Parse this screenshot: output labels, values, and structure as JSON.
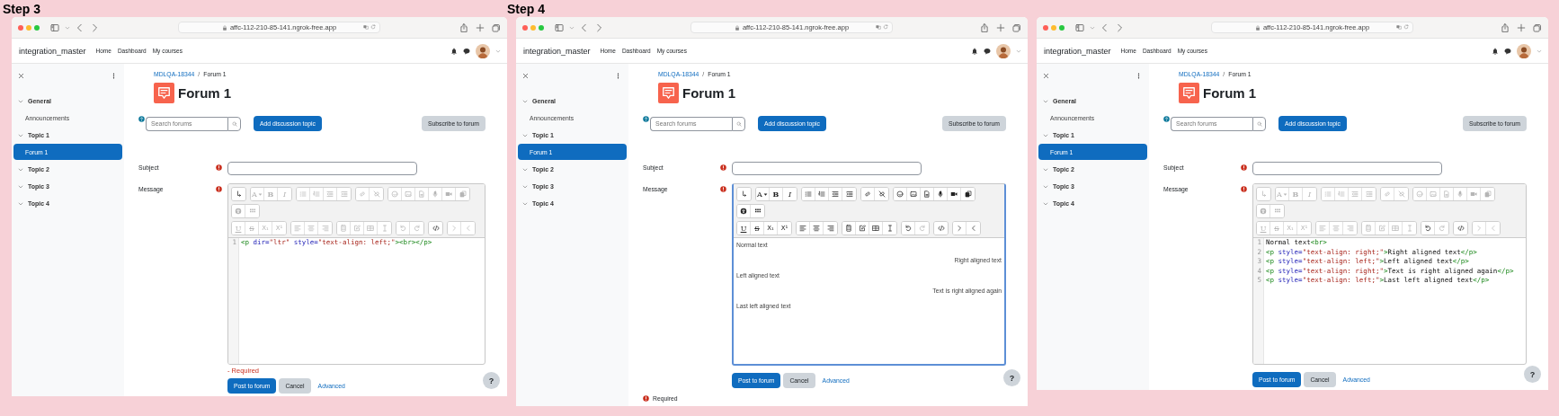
{
  "panels": [
    {
      "step_label": "Step 3",
      "browser": {
        "url": "affc-112-210-85-141.ngrok-free.app"
      },
      "site": {
        "brand": "integration_master",
        "nav": [
          "Home",
          "Dashboard",
          "My courses"
        ]
      },
      "sidebar": [
        {
          "label": "General",
          "expanded": true,
          "children": [
            {
              "label": "Announcements",
              "selected": false
            }
          ]
        },
        {
          "label": "Topic 1",
          "expanded": true,
          "children": [
            {
              "label": "Forum 1",
              "selected": true
            }
          ]
        },
        {
          "label": "Topic 2",
          "expanded": true
        },
        {
          "label": "Topic 3",
          "expanded": true
        },
        {
          "label": "Topic 4",
          "expanded": true
        }
      ],
      "breadcrumb": [
        {
          "label": "MDLQA-18344",
          "kind": "link"
        },
        {
          "label": "/",
          "kind": "separator"
        },
        {
          "label": "Forum 1",
          "kind": "current"
        }
      ],
      "title": "Forum 1",
      "search": {
        "placeholder": "Search forums"
      },
      "actions": [
        {
          "label": "Add discussion topic",
          "kind": "primary"
        },
        {
          "label": "Subscribe to forum",
          "kind": "secondary"
        }
      ],
      "subject": {
        "label": "Subject"
      },
      "message": {
        "label": "Message",
        "error": "- Required",
        "editor": {
          "kind": "source",
          "focused": false,
          "toolbar": [
            [
              [
                {
                  "kind": "expand",
                  "disabled": false
                }
              ],
              [
                {
                  "kind": "font",
                  "label": "A",
                  "disabled": true
                },
                {
                  "kind": "bold",
                  "label": "B",
                  "disabled": true
                },
                {
                  "kind": "italic",
                  "label": "I",
                  "disabled": true
                }
              ],
              [
                {
                  "kind": "ul",
                  "disabled": true
                },
                {
                  "kind": "ol",
                  "disabled": true
                },
                {
                  "kind": "outdent",
                  "disabled": true
                },
                {
                  "kind": "indent",
                  "disabled": true
                }
              ],
              [
                {
                  "kind": "link",
                  "disabled": true
                },
                {
                  "kind": "unlink",
                  "disabled": true
                }
              ],
              [
                {
                  "kind": "emoji",
                  "disabled": true
                },
                {
                  "kind": "image",
                  "disabled": true
                },
                {
                  "kind": "file",
                  "disabled": true
                },
                {
                  "kind": "mic",
                  "disabled": true
                },
                {
                  "kind": "video",
                  "disabled": true
                },
                {
                  "kind": "copy",
                  "disabled": true
                }
              ],
              [
                {
                  "kind": "accessibility",
                  "disabled": true
                },
                {
                  "kind": "grid",
                  "disabled": true
                }
              ]
            ],
            [
              [
                {
                  "kind": "underline",
                  "label": "U",
                  "disabled": true
                },
                {
                  "kind": "strike",
                  "label": "S",
                  "disabled": true
                },
                {
                  "kind": "sub",
                  "label": "X₁",
                  "disabled": true
                },
                {
                  "kind": "sup",
                  "label": "X¹",
                  "disabled": true
                }
              ],
              [
                {
                  "kind": "align-left",
                  "disabled": true
                },
                {
                  "kind": "align-center",
                  "disabled": true
                },
                {
                  "kind": "align-right",
                  "disabled": true
                }
              ],
              [
                {
                  "kind": "calculator",
                  "disabled": true
                },
                {
                  "kind": "edit",
                  "disabled": true
                },
                {
                  "kind": "table",
                  "disabled": true
                },
                {
                  "kind": "cursor",
                  "disabled": true
                }
              ],
              [
                {
                  "kind": "undo",
                  "disabled": true
                },
                {
                  "kind": "redo",
                  "disabled": true
                }
              ],
              [
                {
                  "kind": "code",
                  "disabled": false
                }
              ],
              [
                {
                  "kind": "next",
                  "disabled": true
                },
                {
                  "kind": "prev",
                  "disabled": true
                }
              ]
            ]
          ],
          "lines": [
            {
              "number": "1",
              "tokens": [
                {
                  "kind": "tag",
                  "text": "<p"
                },
                {
                  "kind": "attr",
                  "text": " dir="
                },
                {
                  "kind": "string",
                  "text": "\"ltr\""
                },
                {
                  "kind": "attr",
                  "text": " style="
                },
                {
                  "kind": "string",
                  "text": "\"text-align: left;\""
                },
                {
                  "kind": "tag",
                  "text": "><br></p>"
                }
              ]
            }
          ]
        }
      },
      "buttons": [
        {
          "label": "Post to forum",
          "kind": "primary"
        },
        {
          "label": "Cancel",
          "kind": "secondary"
        },
        {
          "label": "Advanced",
          "kind": "link"
        }
      ],
      "help": "?"
    },
    {
      "step_label": "Step 4",
      "browser": {
        "url": "affc-112-210-85-141.ngrok-free.app"
      },
      "site": {
        "brand": "integration_master",
        "nav": [
          "Home",
          "Dashboard",
          "My courses"
        ]
      },
      "sidebar": [
        {
          "label": "General",
          "expanded": true,
          "children": [
            {
              "label": "Announcements",
              "selected": false
            }
          ]
        },
        {
          "label": "Topic 1",
          "expanded": true,
          "children": [
            {
              "label": "Forum 1",
              "selected": true
            }
          ]
        },
        {
          "label": "Topic 2",
          "expanded": true
        },
        {
          "label": "Topic 3",
          "expanded": true
        },
        {
          "label": "Topic 4",
          "expanded": true
        }
      ],
      "breadcrumb": [
        {
          "label": "MDLQA-18344",
          "kind": "link"
        },
        {
          "label": "/",
          "kind": "separator"
        },
        {
          "label": "Forum 1",
          "kind": "current"
        }
      ],
      "title": "Forum 1",
      "search": {
        "placeholder": "Search forums"
      },
      "actions": [
        {
          "label": "Add discussion topic",
          "kind": "primary"
        },
        {
          "label": "Subscribe to forum",
          "kind": "secondary"
        }
      ],
      "subject": {
        "label": "Subject"
      },
      "message": {
        "label": "Message",
        "editor": {
          "kind": "visual",
          "focused": true,
          "toolbar": [
            [
              [
                {
                  "kind": "expand",
                  "disabled": false
                }
              ],
              [
                {
                  "kind": "font",
                  "label": "A",
                  "disabled": false
                },
                {
                  "kind": "bold",
                  "label": "B",
                  "disabled": false
                },
                {
                  "kind": "italic",
                  "label": "I",
                  "disabled": false
                }
              ],
              [
                {
                  "kind": "ul",
                  "disabled": false
                },
                {
                  "kind": "ol",
                  "disabled": false
                },
                {
                  "kind": "outdent",
                  "disabled": false
                },
                {
                  "kind": "indent",
                  "disabled": false
                }
              ],
              [
                {
                  "kind": "link",
                  "disabled": false
                },
                {
                  "kind": "unlink",
                  "disabled": false
                }
              ],
              [
                {
                  "kind": "emoji",
                  "disabled": false
                },
                {
                  "kind": "image",
                  "disabled": false
                },
                {
                  "kind": "file",
                  "disabled": false
                },
                {
                  "kind": "mic",
                  "disabled": false
                },
                {
                  "kind": "video",
                  "disabled": false
                },
                {
                  "kind": "copy",
                  "disabled": false
                }
              ],
              [
                {
                  "kind": "accessibility",
                  "disabled": false
                },
                {
                  "kind": "grid",
                  "disabled": false
                }
              ]
            ],
            [
              [
                {
                  "kind": "underline",
                  "label": "U",
                  "disabled": false
                },
                {
                  "kind": "strike",
                  "label": "S",
                  "disabled": false
                },
                {
                  "kind": "sub",
                  "label": "X₁",
                  "disabled": false
                },
                {
                  "kind": "sup",
                  "label": "X¹",
                  "disabled": false
                }
              ],
              [
                {
                  "kind": "align-left",
                  "disabled": false
                },
                {
                  "kind": "align-center",
                  "disabled": false
                },
                {
                  "kind": "align-right",
                  "disabled": false
                }
              ],
              [
                {
                  "kind": "calculator",
                  "disabled": false
                },
                {
                  "kind": "edit",
                  "disabled": false
                },
                {
                  "kind": "table",
                  "disabled": false
                },
                {
                  "kind": "cursor",
                  "disabled": false
                }
              ],
              [
                {
                  "kind": "undo",
                  "disabled": false
                },
                {
                  "kind": "redo",
                  "disabled": true
                }
              ],
              [
                {
                  "kind": "code",
                  "disabled": false
                }
              ],
              [
                {
                  "kind": "next",
                  "disabled": false
                },
                {
                  "kind": "prev",
                  "disabled": false
                }
              ]
            ]
          ],
          "paragraphs": [
            {
              "kind": "text",
              "text": "Normal text",
              "right_aligned": false
            },
            {
              "kind": "paragraph",
              "text": "Right aligned text",
              "right_aligned": true
            },
            {
              "kind": "paragraph",
              "text": "Left aligned text",
              "right_aligned": false
            },
            {
              "kind": "paragraph",
              "text": "Text is right aligned again",
              "right_aligned": true
            },
            {
              "kind": "paragraph",
              "text": "Last left aligned text",
              "right_aligned": false
            }
          ]
        }
      },
      "buttons": [
        {
          "label": "Post to forum",
          "kind": "primary"
        },
        {
          "label": "Cancel",
          "kind": "secondary"
        },
        {
          "label": "Advanced",
          "kind": "link"
        }
      ],
      "required_note": "Required",
      "help": "?"
    },
    {
      "browser": {
        "url": "affc-112-210-85-141.ngrok-free.app"
      },
      "site": {
        "brand": "integration_master",
        "nav": [
          "Home",
          "Dashboard",
          "My courses"
        ]
      },
      "sidebar": [
        {
          "label": "General",
          "expanded": true,
          "children": [
            {
              "label": "Announcements",
              "selected": false
            }
          ]
        },
        {
          "label": "Topic 1",
          "expanded": true,
          "children": [
            {
              "label": "Forum 1",
              "selected": true
            }
          ]
        },
        {
          "label": "Topic 2",
          "expanded": true
        },
        {
          "label": "Topic 3",
          "expanded": true
        },
        {
          "label": "Topic 4",
          "expanded": true
        }
      ],
      "breadcrumb": [
        {
          "label": "MDLQA-18344",
          "kind": "link"
        },
        {
          "label": "/",
          "kind": "separator"
        },
        {
          "label": "Forum 1",
          "kind": "current"
        }
      ],
      "title": "Forum 1",
      "search": {
        "placeholder": "Search forums"
      },
      "actions": [
        {
          "label": "Add discussion topic",
          "kind": "primary"
        },
        {
          "label": "Subscribe to forum",
          "kind": "secondary"
        }
      ],
      "subject": {
        "label": "Subject"
      },
      "message": {
        "label": "Message",
        "editor": {
          "kind": "source",
          "focused": false,
          "toolbar": [
            [
              [
                {
                  "kind": "expand",
                  "disabled": true
                }
              ],
              [
                {
                  "kind": "font",
                  "label": "A",
                  "disabled": true
                },
                {
                  "kind": "bold",
                  "label": "B",
                  "disabled": true
                },
                {
                  "kind": "italic",
                  "label": "I",
                  "disabled": true
                }
              ],
              [
                {
                  "kind": "ul",
                  "disabled": true
                },
                {
                  "kind": "ol",
                  "disabled": true
                },
                {
                  "kind": "outdent",
                  "disabled": true
                },
                {
                  "kind": "indent",
                  "disabled": true
                }
              ],
              [
                {
                  "kind": "link",
                  "disabled": true
                },
                {
                  "kind": "unlink",
                  "disabled": true
                }
              ],
              [
                {
                  "kind": "emoji",
                  "disabled": true
                },
                {
                  "kind": "image",
                  "disabled": true
                },
                {
                  "kind": "file",
                  "disabled": true
                },
                {
                  "kind": "mic",
                  "disabled": true
                },
                {
                  "kind": "video",
                  "disabled": true
                },
                {
                  "kind": "copy",
                  "disabled": true
                }
              ],
              [
                {
                  "kind": "accessibility",
                  "disabled": true
                },
                {
                  "kind": "grid",
                  "disabled": true
                }
              ]
            ],
            [
              [
                {
                  "kind": "underline",
                  "label": "U",
                  "disabled": true
                },
                {
                  "kind": "strike",
                  "label": "S",
                  "disabled": true
                },
                {
                  "kind": "sub",
                  "label": "X₁",
                  "disabled": true
                },
                {
                  "kind": "sup",
                  "label": "X¹",
                  "disabled": true
                }
              ],
              [
                {
                  "kind": "align-left",
                  "disabled": true
                },
                {
                  "kind": "align-center",
                  "disabled": true
                },
                {
                  "kind": "align-right",
                  "disabled": true
                }
              ],
              [
                {
                  "kind": "calculator",
                  "disabled": true
                },
                {
                  "kind": "edit",
                  "disabled": true
                },
                {
                  "kind": "table",
                  "disabled": true
                },
                {
                  "kind": "cursor",
                  "disabled": true
                }
              ],
              [
                {
                  "kind": "undo",
                  "disabled": false
                },
                {
                  "kind": "redo",
                  "disabled": true
                }
              ],
              [
                {
                  "kind": "code",
                  "disabled": false
                }
              ],
              [
                {
                  "kind": "next",
                  "disabled": true
                },
                {
                  "kind": "prev",
                  "disabled": true
                }
              ]
            ]
          ],
          "lines": [
            {
              "number": "1",
              "tokens": [
                {
                  "kind": "text",
                  "text": "Normal text"
                },
                {
                  "kind": "tag",
                  "text": "<br>"
                }
              ]
            },
            {
              "number": "2",
              "tokens": [
                {
                  "kind": "tag",
                  "text": "<p"
                },
                {
                  "kind": "attr",
                  "text": " style="
                },
                {
                  "kind": "string",
                  "text": "\"text-align: right;\""
                },
                {
                  "kind": "tag",
                  "text": ">"
                },
                {
                  "kind": "text",
                  "text": "Right aligned text"
                },
                {
                  "kind": "tag",
                  "text": "</p>"
                }
              ]
            },
            {
              "number": "3",
              "tokens": [
                {
                  "kind": "tag",
                  "text": "<p"
                },
                {
                  "kind": "attr",
                  "text": " style="
                },
                {
                  "kind": "string",
                  "text": "\"text-align: left;\""
                },
                {
                  "kind": "tag",
                  "text": ">"
                },
                {
                  "kind": "text",
                  "text": "Left aligned text"
                },
                {
                  "kind": "tag",
                  "text": "</p>"
                }
              ]
            },
            {
              "number": "4",
              "tokens": [
                {
                  "kind": "tag",
                  "text": "<p"
                },
                {
                  "kind": "attr",
                  "text": " style="
                },
                {
                  "kind": "string",
                  "text": "\"text-align: right;\""
                },
                {
                  "kind": "tag",
                  "text": ">"
                },
                {
                  "kind": "text",
                  "text": "Text is right aligned again"
                },
                {
                  "kind": "tag",
                  "text": "</p>"
                }
              ]
            },
            {
              "number": "5",
              "tokens": [
                {
                  "kind": "tag",
                  "text": "<p"
                },
                {
                  "kind": "attr",
                  "text": " style="
                },
                {
                  "kind": "string",
                  "text": "\"text-align: left;\""
                },
                {
                  "kind": "tag",
                  "text": ">"
                },
                {
                  "kind": "text",
                  "text": "Last left aligned text"
                },
                {
                  "kind": "tag",
                  "text": "</p>"
                }
              ]
            }
          ]
        }
      },
      "buttons": [
        {
          "label": "Post to forum",
          "kind": "primary"
        },
        {
          "label": "Cancel",
          "kind": "secondary"
        },
        {
          "label": "Advanced",
          "kind": "link"
        }
      ],
      "help": "?"
    }
  ]
}
